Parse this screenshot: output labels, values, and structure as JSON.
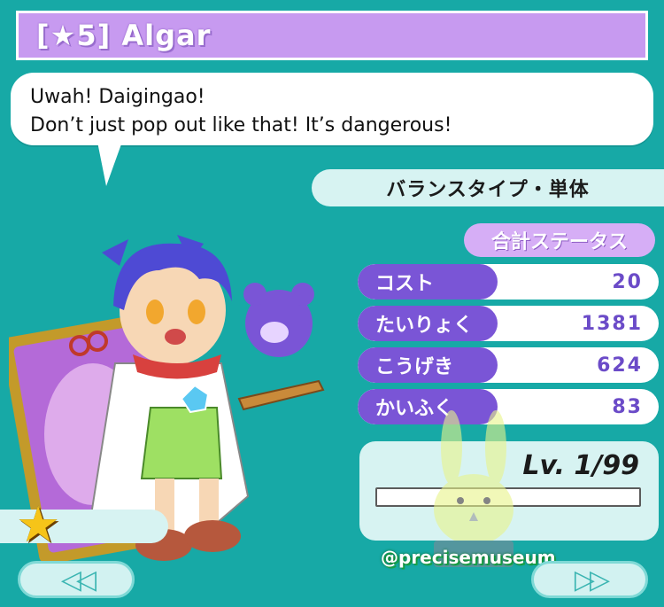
{
  "header": {
    "title": "[★5] Algar"
  },
  "dialogue": {
    "line1": "Uwah! Daigingao!",
    "line2": "Don’t just pop out like that! It’s dangerous!"
  },
  "type_label": "バランスタイプ・単体",
  "total_status_label": "合計ステータス",
  "stats": [
    {
      "label": "コスト",
      "value": "20"
    },
    {
      "label": "たいりょく",
      "value": "1381"
    },
    {
      "label": "こうげき",
      "value": "624"
    },
    {
      "label": "かいふく",
      "value": "83"
    }
  ],
  "level": {
    "text": "Lv. 1/99",
    "fill_fraction": 0.0
  },
  "rarity": {
    "stars": 1
  },
  "nav": {
    "prev_label": "◁◁",
    "next_label": "▷▷"
  },
  "watermark": "@precisemuseum",
  "colors": {
    "background": "#17a9a6",
    "title_bar": "#c79af0",
    "stat_label": "#7a55d6",
    "panel": "#d7f3f2"
  }
}
